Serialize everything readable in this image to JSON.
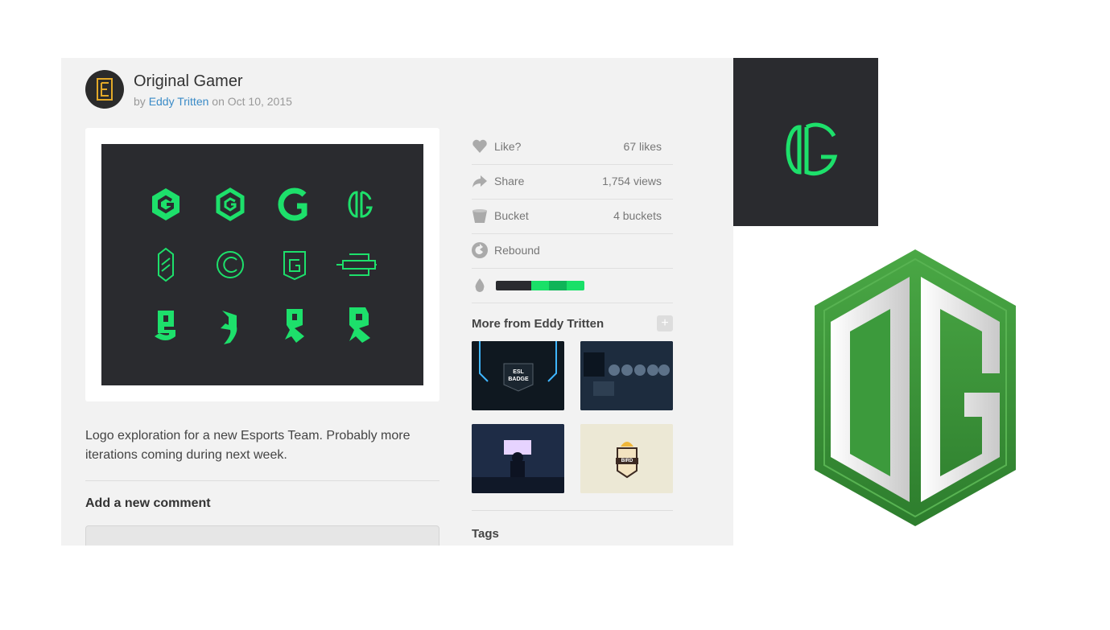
{
  "post": {
    "title": "Original Gamer",
    "by": "by",
    "author": "Eddy Tritten",
    "on": "on",
    "date": "Oct 10, 2015",
    "description": "Logo exploration for a new Esports Team. Probably more iterations coming during next week."
  },
  "stats": {
    "like": {
      "label": "Like?",
      "value": "67 likes",
      "icon": "heart-icon"
    },
    "share": {
      "label": "Share",
      "value": "1,754 views",
      "icon": "share-arrow-icon"
    },
    "bucket": {
      "label": "Bucket",
      "value": "4 buckets",
      "icon": "bucket-icon"
    },
    "rebound": {
      "label": "Rebound",
      "icon": "rebound-icon"
    }
  },
  "palette": {
    "icon": "drop-icon",
    "colors": [
      "#2a2b2f",
      "#2a2b2f",
      "#19e068",
      "#0fb458",
      "#19e068"
    ]
  },
  "more": {
    "heading": "More from Eddy Tritten",
    "plus": "+",
    "shots": [
      {
        "label": "ESL BADGE"
      },
      {
        "label": ""
      },
      {
        "label": ""
      },
      {
        "label": "BIRD"
      }
    ]
  },
  "comments": {
    "heading": "Add a new comment"
  },
  "tags": {
    "heading": "Tags"
  },
  "colors": {
    "accent_green": "#1de06b",
    "dark_bg": "#2a2b2f",
    "link_blue": "#3a8bc7",
    "og_green": "#3c9a3c"
  }
}
